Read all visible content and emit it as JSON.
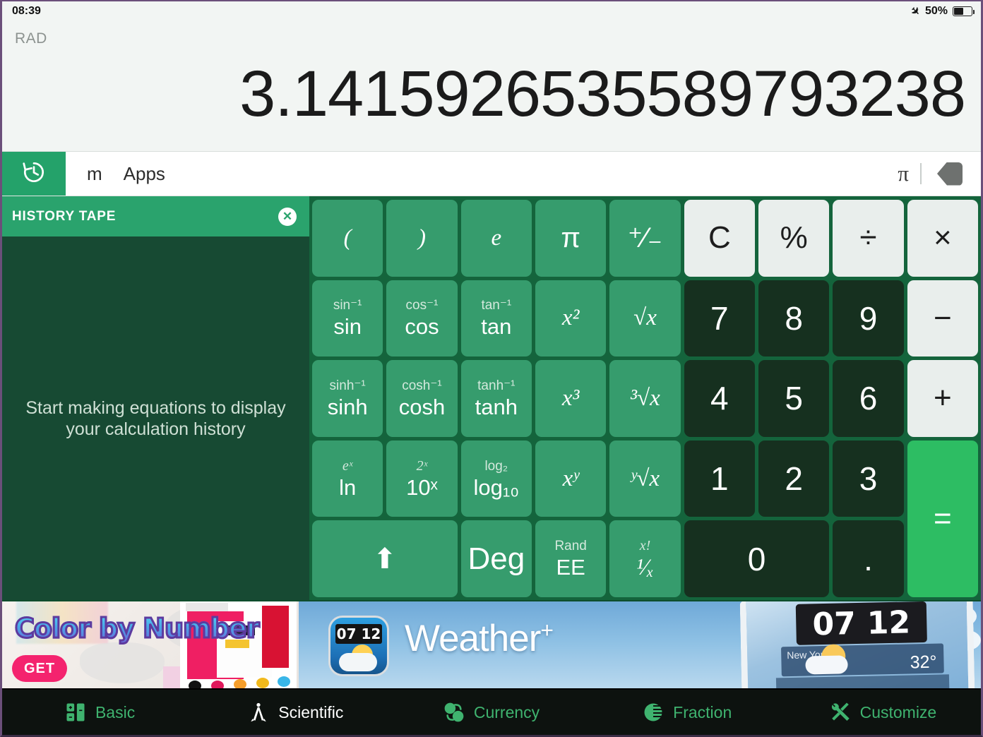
{
  "status_bar": {
    "time": "08:39",
    "airplane_icon": "airplane-icon",
    "battery_percent": "50%",
    "battery_icon": "battery-icon"
  },
  "display": {
    "angle_mode": "RAD",
    "value": "3.1415926535589793238"
  },
  "toolbar": {
    "history_icon": "history-clock-icon",
    "items": [
      {
        "label": "m",
        "name": "memory"
      },
      {
        "label": "Apps",
        "name": "apps"
      }
    ],
    "pi_label": "π",
    "backspace_icon": "backspace-icon",
    "backspace_glyph": "×"
  },
  "history_panel": {
    "title": "HISTORY TAPE",
    "close_glyph": "✕",
    "empty_message": "Start making equations to display your calculation history"
  },
  "keypad": {
    "colors": {
      "function_key": "#369c6d",
      "light_key": "#e9eeec",
      "dark_key": "#16301f",
      "equals_key": "#2dbd63",
      "pad_background": "#14643c"
    },
    "rows": [
      {
        "keys": [
          {
            "name": "open-paren",
            "main": "(",
            "sub": "",
            "style": "fn"
          },
          {
            "name": "close-paren",
            "main": ")",
            "sub": "",
            "style": "fn"
          },
          {
            "name": "euler-e",
            "main": "e",
            "sub": "",
            "style": "fn"
          },
          {
            "name": "pi",
            "main": "π",
            "sub": "",
            "style": "fn"
          },
          {
            "name": "plus-minus",
            "main": "⁺⁄₋",
            "sub": "",
            "style": "fn"
          },
          {
            "name": "clear",
            "main": "C",
            "sub": "",
            "style": "light"
          },
          {
            "name": "percent",
            "main": "%",
            "sub": "",
            "style": "light"
          },
          {
            "name": "divide",
            "main": "÷",
            "sub": "",
            "style": "light"
          },
          {
            "name": "multiply",
            "main": "×",
            "sub": "",
            "style": "light"
          }
        ]
      },
      {
        "keys": [
          {
            "name": "sin",
            "main": "sin",
            "sub": "sin⁻¹",
            "style": "fn"
          },
          {
            "name": "cos",
            "main": "cos",
            "sub": "cos⁻¹",
            "style": "fn"
          },
          {
            "name": "tan",
            "main": "tan",
            "sub": "tan⁻¹",
            "style": "fn"
          },
          {
            "name": "x-squared",
            "main": "x²",
            "sub": "",
            "style": "fn"
          },
          {
            "name": "square-root",
            "main": "√x",
            "sub": "",
            "style": "fn"
          },
          {
            "name": "digit-7",
            "main": "7",
            "sub": "",
            "style": "dark"
          },
          {
            "name": "digit-8",
            "main": "8",
            "sub": "",
            "style": "dark"
          },
          {
            "name": "digit-9",
            "main": "9",
            "sub": "",
            "style": "dark"
          },
          {
            "name": "minus",
            "main": "−",
            "sub": "",
            "style": "light"
          }
        ]
      },
      {
        "keys": [
          {
            "name": "sinh",
            "main": "sinh",
            "sub": "sinh⁻¹",
            "style": "fn"
          },
          {
            "name": "cosh",
            "main": "cosh",
            "sub": "cosh⁻¹",
            "style": "fn"
          },
          {
            "name": "tanh",
            "main": "tanh",
            "sub": "tanh⁻¹",
            "style": "fn"
          },
          {
            "name": "x-cubed",
            "main": "x³",
            "sub": "",
            "style": "fn"
          },
          {
            "name": "cube-root",
            "main": "³√x",
            "sub": "",
            "style": "fn"
          },
          {
            "name": "digit-4",
            "main": "4",
            "sub": "",
            "style": "dark"
          },
          {
            "name": "digit-5",
            "main": "5",
            "sub": "",
            "style": "dark"
          },
          {
            "name": "digit-6",
            "main": "6",
            "sub": "",
            "style": "dark"
          },
          {
            "name": "plus",
            "main": "+",
            "sub": "",
            "style": "light"
          }
        ]
      },
      {
        "keys": [
          {
            "name": "natural-log",
            "main": "ln",
            "sub": "eˣ",
            "style": "fn"
          },
          {
            "name": "ten-power-x",
            "main": "10ˣ",
            "sub": "2ˣ",
            "style": "fn"
          },
          {
            "name": "log-base-10",
            "main": "log₁₀",
            "sub": "log₂",
            "style": "fn"
          },
          {
            "name": "x-power-y",
            "main": "xʸ",
            "sub": "",
            "style": "fn"
          },
          {
            "name": "y-root-x",
            "main": "ʸ√x",
            "sub": "",
            "style": "fn"
          },
          {
            "name": "digit-1",
            "main": "1",
            "sub": "",
            "style": "dark"
          },
          {
            "name": "digit-2",
            "main": "2",
            "sub": "",
            "style": "dark"
          },
          {
            "name": "digit-3",
            "main": "3",
            "sub": "",
            "style": "dark"
          },
          {
            "name": "equals",
            "main": "=",
            "sub": "",
            "style": "eq"
          }
        ]
      },
      {
        "keys": [
          {
            "name": "shift",
            "main": "⬆",
            "sub": "",
            "style": "fn"
          },
          {
            "name": "angle-unit-deg",
            "main": "Deg",
            "sub": "",
            "style": "fn"
          },
          {
            "name": "exponent-ee",
            "main": "EE",
            "sub": "Rand",
            "style": "fn"
          },
          {
            "name": "reciprocal",
            "main": "¹⁄ₓ",
            "sub": "x!",
            "style": "fn"
          },
          {
            "name": "digit-0",
            "main": "0",
            "sub": "",
            "style": "dark"
          },
          {
            "name": "decimal-point",
            "main": ".",
            "sub": "",
            "style": "dark"
          }
        ]
      }
    ]
  },
  "ad_banner": {
    "left_ad": {
      "title": "Color by Number",
      "cta": "GET"
    },
    "right_ad": {
      "title": "Weather",
      "plus": "+",
      "icon_clock": "07 12",
      "tablet_clock_hours": "07",
      "tablet_clock_minutes": "12",
      "tablet_city": "New York",
      "tablet_temp": "32°"
    }
  },
  "bottom_nav": {
    "items": [
      {
        "label": "Basic",
        "icon": "calculator-icon",
        "active": false
      },
      {
        "label": "Scientific",
        "icon": "compass-icon",
        "active": true
      },
      {
        "label": "Currency",
        "icon": "currency-exchange-icon",
        "active": false
      },
      {
        "label": "Fraction",
        "icon": "pie-chart-icon",
        "active": false
      },
      {
        "label": "Customize",
        "icon": "tools-icon",
        "active": false
      }
    ]
  }
}
